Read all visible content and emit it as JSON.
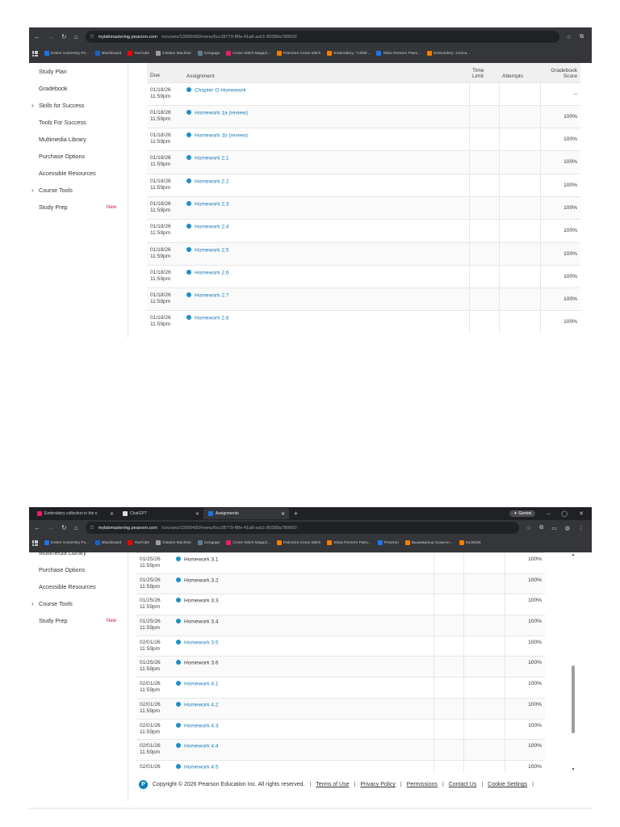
{
  "shot_top": {
    "omnibox": {
      "host": "mylabmastering.pearson.com",
      "path": "/courses/13950430/menu/6cc28779-f8fe-41a8-acb1-80389a780600"
    },
    "bookmarks": [
      "Keiser University Po...",
      "Blackboard",
      "YouTube",
      "Citation Machine",
      "Cengage",
      "Cross Stitch Magazi...",
      "Patrones Cross Stitch",
      "Embroidery: \"Childr...",
      "Silvia Romero Patro...",
      "Embroidery: Corica..."
    ],
    "sidebar": [
      {
        "label": "Study Plan",
        "chevron": false
      },
      {
        "label": "Gradebook",
        "chevron": false
      },
      {
        "label": "Skills for Success",
        "chevron": true
      },
      {
        "label": "Tools For Success",
        "chevron": false
      },
      {
        "label": "Multimedia Library",
        "chevron": false
      },
      {
        "label": "Purchase Options",
        "chevron": false
      },
      {
        "label": "Accessible Resources",
        "chevron": false
      },
      {
        "label": "Course Tools",
        "chevron": true
      },
      {
        "label": "Study Prep",
        "chevron": false,
        "badge": "New"
      }
    ],
    "table": {
      "headers": {
        "due": "Due",
        "assignment": "Assignment",
        "time_limit": "Time Limit",
        "attempts": "Attempts",
        "score": "Gradebook Score"
      },
      "rows": [
        {
          "due": "01/18/26",
          "time": "11:59pm",
          "name": "Chapter O Homework",
          "score": "--"
        },
        {
          "due": "01/18/26",
          "time": "11:59pm",
          "name": "Homework 1a (review)",
          "score": "100%"
        },
        {
          "due": "01/18/26",
          "time": "11:59pm",
          "name": "Homework 1b (review)",
          "score": "100%"
        },
        {
          "due": "01/18/26",
          "time": "11:59pm",
          "name": "Homework 2.1",
          "score": "100%"
        },
        {
          "due": "01/18/26",
          "time": "11:59pm",
          "name": "Homework 2.2",
          "score": "100%"
        },
        {
          "due": "01/18/26",
          "time": "11:59pm",
          "name": "Homework 2.3",
          "score": "100%"
        },
        {
          "due": "01/18/26",
          "time": "11:59pm",
          "name": "Homework 2.4",
          "score": "100%"
        },
        {
          "due": "01/18/26",
          "time": "11:59pm",
          "name": "Homework 2.5",
          "score": "100%"
        },
        {
          "due": "01/18/26",
          "time": "11:59pm",
          "name": "Homework 2.6",
          "score": "100%"
        },
        {
          "due": "01/18/26",
          "time": "11:59pm",
          "name": "Homework 2.7",
          "score": "100%"
        },
        {
          "due": "01/18/26",
          "time": "11:59pm",
          "name": "Homework 2.8",
          "score": "100%"
        }
      ]
    }
  },
  "shot_bottom": {
    "tabs": [
      {
        "label": "Embroidery collection in the n",
        "active": false,
        "color": "#e91e63"
      },
      {
        "label": "ChatGPT",
        "active": false,
        "color": "#dddddd"
      },
      {
        "label": "Assignments",
        "active": true,
        "color": "#1a73e8"
      }
    ],
    "gemini_label": "Gemini",
    "omnibox": {
      "host": "mylabmastering.pearson.com",
      "path": "/courses/13950430/menu/6cc28779-f8fe-41a8-acb1-80389a780600"
    },
    "bookmarks": [
      "Keiser University Po...",
      "Blackboard",
      "YouTube",
      "Citation Machine",
      "Cengage",
      "Cross Stitch Magazi...",
      "Patrones Cross Stitch",
      "Silvia Romero Patro...",
      "Pearson",
      "Вышивальщ Сказочн...",
      "01/26/26"
    ],
    "sidebar": [
      {
        "label": "Multimedia Library",
        "chevron": false
      },
      {
        "label": "Purchase Options",
        "chevron": false
      },
      {
        "label": "Accessible Resources",
        "chevron": false
      },
      {
        "label": "Course Tools",
        "chevron": true
      },
      {
        "label": "Study Prep",
        "chevron": false,
        "badge": "New"
      }
    ],
    "rows": [
      {
        "due": "01/25/26",
        "time": "11:59pm",
        "name": "Homework 3.1",
        "score": "100%",
        "link": false
      },
      {
        "due": "01/25/26",
        "time": "11:59pm",
        "name": "Homework 3.2",
        "score": "100%",
        "link": false
      },
      {
        "due": "01/25/26",
        "time": "11:59pm",
        "name": "Homework 3.3",
        "score": "100%",
        "link": false
      },
      {
        "due": "01/25/26",
        "time": "11:59pm",
        "name": "Homework 3.4",
        "score": "100%",
        "link": false
      },
      {
        "due": "02/01/26",
        "time": "11:59pm",
        "name": "Homework 3.5",
        "score": "100%",
        "link": true
      },
      {
        "due": "01/25/26",
        "time": "11:59pm",
        "name": "Homework 3.6",
        "score": "100%",
        "link": false
      },
      {
        "due": "02/01/26",
        "time": "11:59pm",
        "name": "Homework 4.1",
        "score": "100%",
        "link": true
      },
      {
        "due": "02/01/26",
        "time": "11:59pm",
        "name": "Homework 4.2",
        "score": "100%",
        "link": true
      },
      {
        "due": "02/01/26",
        "time": "11:59pm",
        "name": "Homework 4.3",
        "score": "100%",
        "link": true
      },
      {
        "due": "02/01/26",
        "time": "11:59pm",
        "name": "Homework 4.4",
        "score": "100%",
        "link": true
      },
      {
        "due": "02/01/26",
        "time": "",
        "name": "Homework 4.5",
        "score": "100%",
        "link": true
      }
    ],
    "footer": {
      "logo": "P",
      "copyright": "Copyright © 2026 Pearson Education Inc. All rights reserved.",
      "links": [
        "Terms of Use",
        "Privacy Policy",
        "Permissions",
        "Contact Us",
        "Cookie Settings"
      ]
    }
  },
  "colors": {
    "chrome": "#35363a",
    "link": "#1a7bb8",
    "dot": "#1c8fc6",
    "new_badge": "#c2185b"
  },
  "icons": [
    "back-icon",
    "forward-icon",
    "reload-icon",
    "home-icon",
    "site-info-icon",
    "star-icon",
    "extensions-icon",
    "apps-icon",
    "close-icon",
    "minimize-icon",
    "maximize-icon",
    "chevron-right-icon",
    "status-dot-icon",
    "scroll-up-icon",
    "scroll-down-icon"
  ]
}
